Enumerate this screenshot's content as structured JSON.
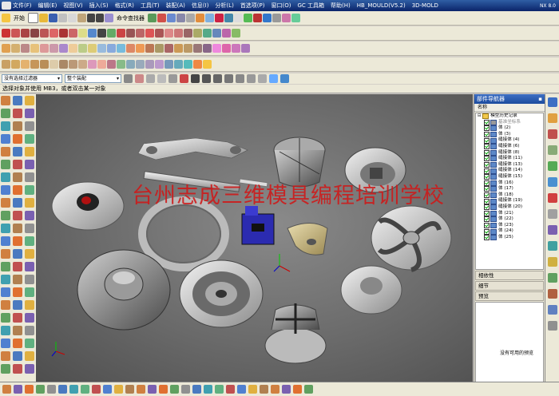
{
  "menu": {
    "items": [
      "文件(F)",
      "编辑(E)",
      "视图(V)",
      "插入(S)",
      "格式(R)",
      "工具(T)",
      "装配(A)",
      "信息(I)",
      "分析(L)",
      "首选项(P)",
      "窗口(O)",
      "GC 工具箱",
      "帮助(H)",
      "HB_MOULD(V5.2)",
      "3D-MOLD"
    ],
    "version": "NX 8.0"
  },
  "toolbar": {
    "start_label": "开始",
    "command_finder_label": "命令查找器"
  },
  "selection": {
    "filter_value": "没有选择过滤器",
    "scope_value": "整个装配"
  },
  "status": {
    "prompt": "选择对象并使用 MB3，或者双击某一对象"
  },
  "watermark": "台州志成三维模具编程培训学校",
  "navigator": {
    "title": "部件导航器",
    "column_name": "名称",
    "root": "模型历史记录",
    "first_child": "基准坐标系",
    "items": [
      "体 (2)",
      "体 (3)",
      "缝接体 (4)",
      "缝接体 (6)",
      "缝接体 (8)",
      "缝接体 (11)",
      "缝接体 (13)",
      "缝接体 (14)",
      "缝接体 (15)",
      "体 (16)",
      "体 (17)",
      "体 (18)",
      "缝接体 (19)",
      "缝接体 (20)",
      "体 (21)",
      "体 (22)",
      "体 (23)",
      "体 (24)",
      "体 (25)"
    ]
  },
  "panels": {
    "dependency": "相依性",
    "details": "细节",
    "preview": "预览",
    "no_preview": "没有可用的预览"
  },
  "colors": {
    "watermark": "#d01818",
    "titlebar": "#0a246a",
    "viewport": "#6a6a6a"
  }
}
